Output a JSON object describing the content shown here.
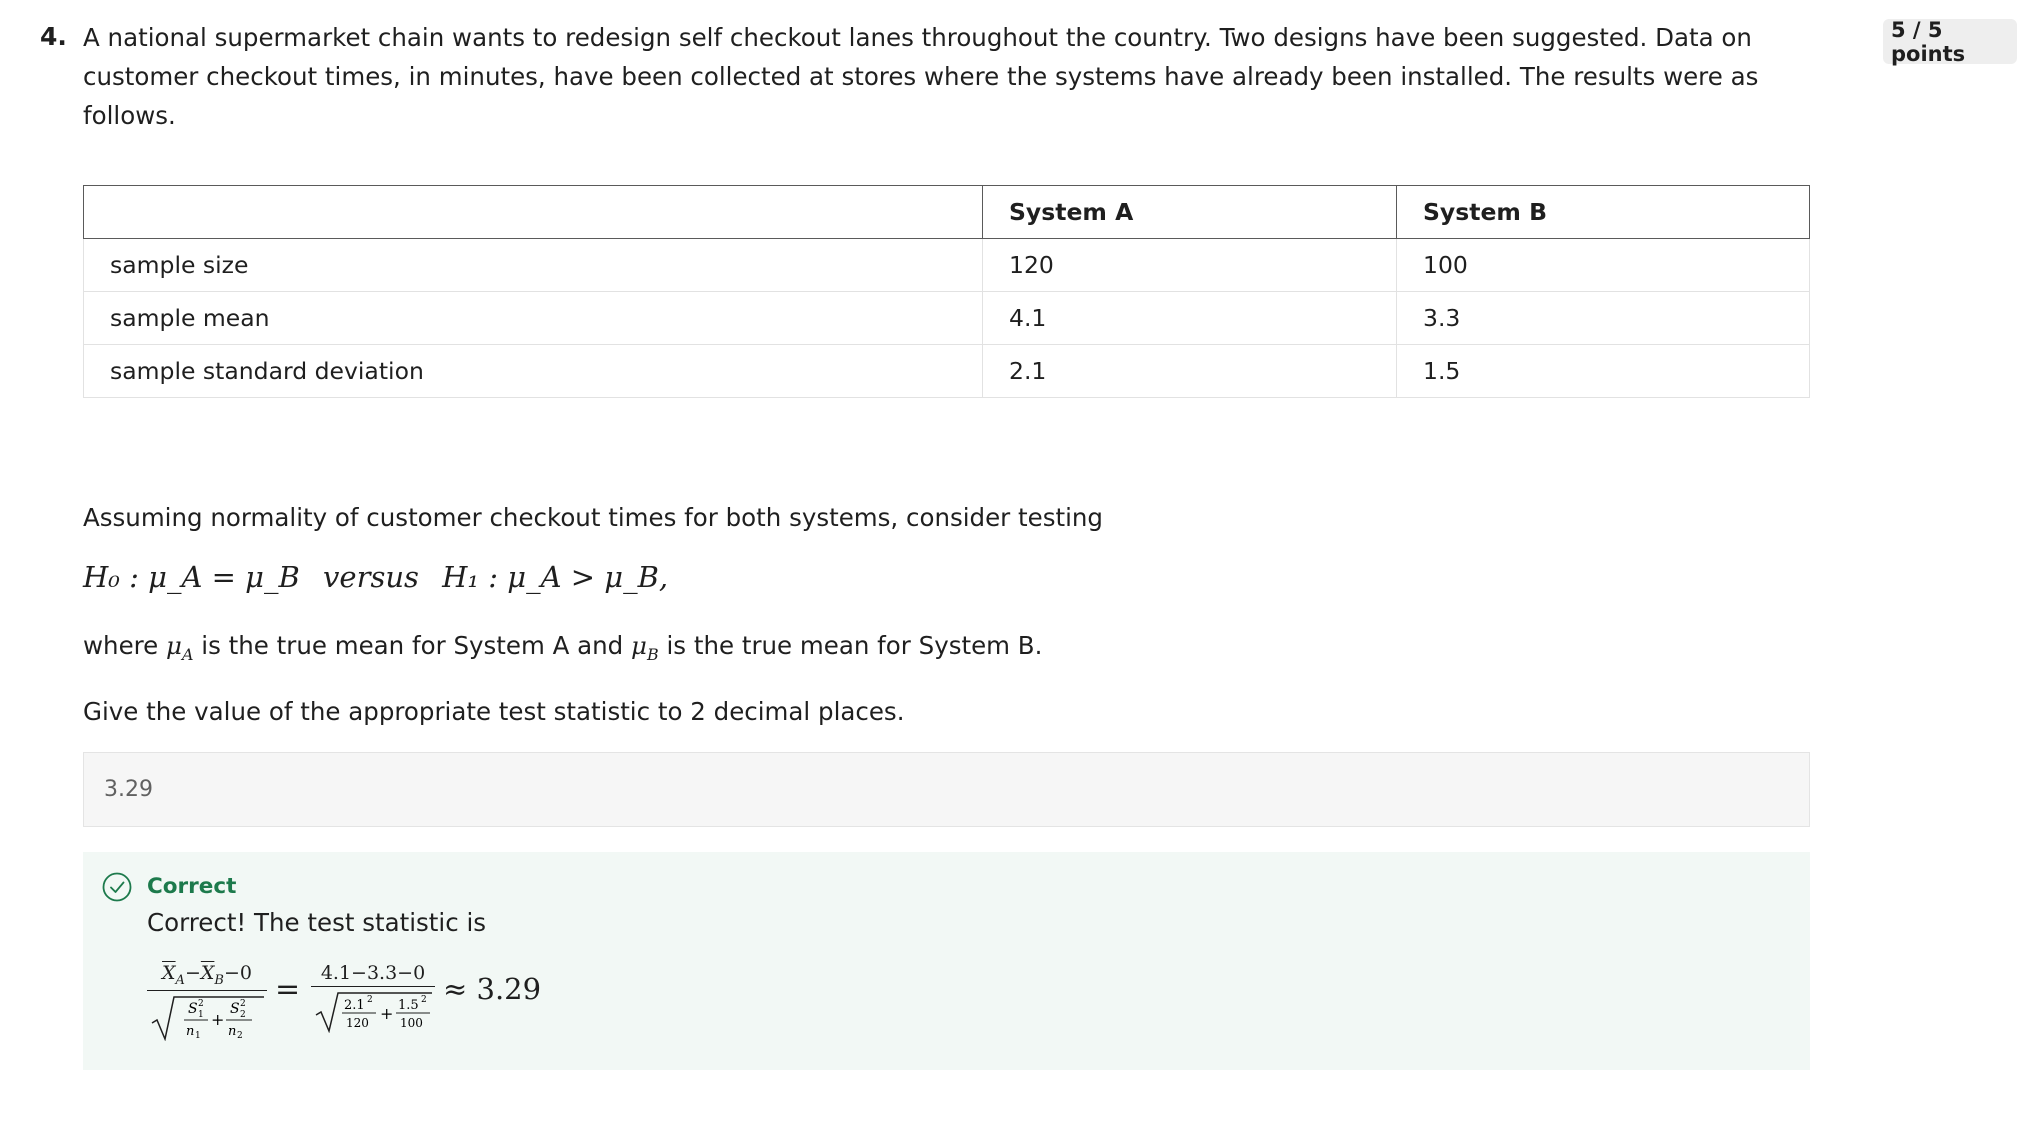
{
  "question": {
    "number": "4.",
    "prompt": "A national supermarket chain wants to redesign self checkout lanes throughout the country. Two designs have been suggested. Data on customer checkout times, in minutes, have been collected at stores where the systems have already been installed. The results were as follows.",
    "points": "5 / 5 points"
  },
  "table": {
    "headers": [
      "",
      "System A",
      "System B"
    ],
    "rows": [
      [
        "sample size",
        "120",
        "100"
      ],
      [
        "sample mean",
        "4.1",
        "3.3"
      ],
      [
        "sample standard deviation",
        "2.1",
        "1.5"
      ]
    ]
  },
  "body": {
    "intro": "Assuming normality of customer checkout times for both systems, consider testing",
    "hypothesis": {
      "h0": "H₀ : μ_A = μ_B",
      "versus": "versus",
      "h1": "H₁ : μ_A > μ_B,"
    },
    "where_prefix": "where",
    "where_mid": "is the true mean for System A and",
    "where_suffix": "is the true mean for System B.",
    "instruction": "Give the value of the appropriate test statistic to 2 decimal places."
  },
  "answer": {
    "value": "3.29"
  },
  "feedback": {
    "status": "Correct",
    "text": "Correct! The test statistic is",
    "result": "≈ 3.29"
  },
  "colors": {
    "correct_green": "#1d7a4c",
    "feedback_bg": "#f2f8f5",
    "answer_bg": "#f6f6f6"
  },
  "icons": {
    "status": "check-circle-icon"
  }
}
